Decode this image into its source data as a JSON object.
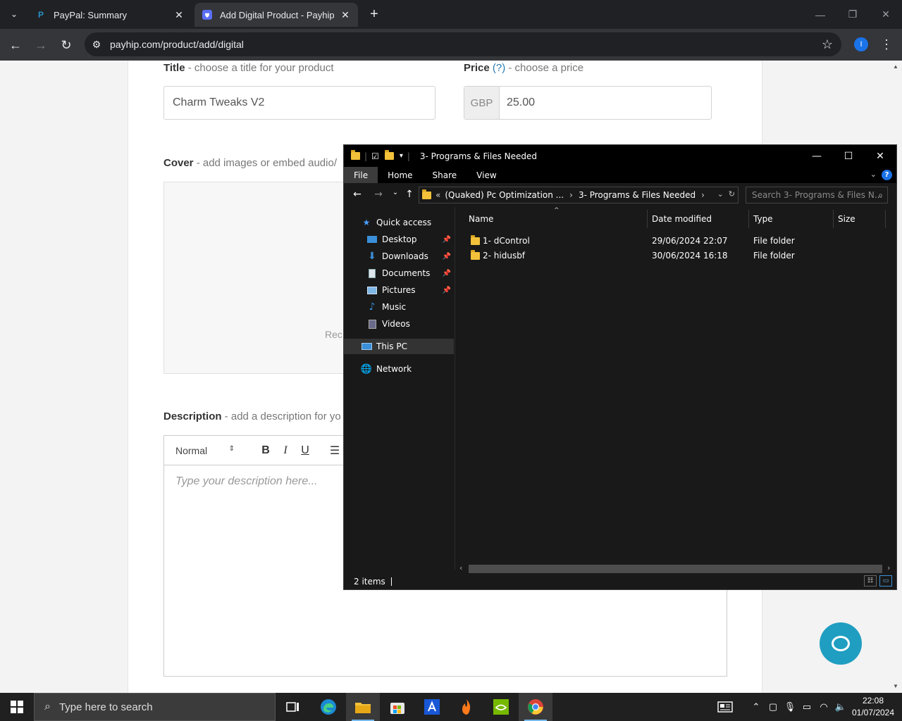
{
  "browser": {
    "tabs": [
      {
        "title": "PayPal: Summary",
        "active": false
      },
      {
        "title": "Add Digital Product - Payhip",
        "active": true
      }
    ],
    "url": "payhip.com/product/add/digital",
    "profile_initial": "I"
  },
  "page": {
    "title_label": "Title",
    "title_hint": " - choose a title for your product",
    "title_value": "Charm Tweaks V2",
    "price_label": "Price",
    "price_help": "(?)",
    "price_hint": " - choose a price",
    "currency": "GBP",
    "price_value": "25.00",
    "cover_label": "Cover",
    "cover_hint": " - add images or embed audio/",
    "cover_box_text": "Rec",
    "description_label": "Description",
    "description_hint": " - add a description for yo",
    "editor_format": "Normal",
    "editor_placeholder": "Type your description here..."
  },
  "explorer": {
    "window_title": "3- Programs & Files Needed",
    "ribbon_tabs": [
      "File",
      "Home",
      "Share",
      "View"
    ],
    "breadcrumb": [
      "(Quaked) Pc Optimization ...",
      "3- Programs & Files Needed"
    ],
    "search_placeholder": "Search 3- Programs & Files N...",
    "nav": {
      "quick_access": "Quick access",
      "desktop": "Desktop",
      "downloads": "Downloads",
      "documents": "Documents",
      "pictures": "Pictures",
      "music": "Music",
      "videos": "Videos",
      "this_pc": "This PC",
      "network": "Network"
    },
    "columns": {
      "name": "Name",
      "date": "Date modified",
      "type": "Type",
      "size": "Size"
    },
    "files": [
      {
        "name": "1- dControl",
        "date": "29/06/2024 22:07",
        "type": "File folder",
        "size": ""
      },
      {
        "name": "2- hidusbf",
        "date": "30/06/2024 16:18",
        "type": "File folder",
        "size": ""
      }
    ],
    "status": "2 items"
  },
  "taskbar": {
    "search_placeholder": "Type here to search",
    "time": "22:08",
    "date": "01/07/2024"
  }
}
